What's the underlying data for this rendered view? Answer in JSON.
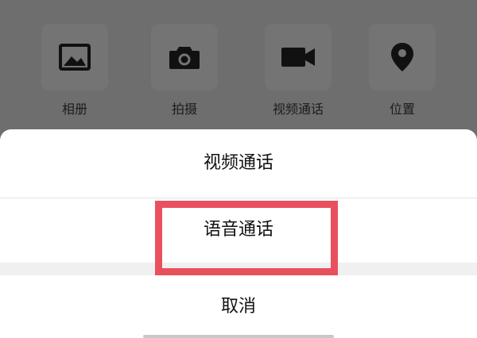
{
  "tools": [
    {
      "label": "相册",
      "icon": "image-icon"
    },
    {
      "label": "拍摄",
      "icon": "camera-icon"
    },
    {
      "label": "视频通话",
      "icon": "video-icon"
    },
    {
      "label": "位置",
      "icon": "location-pin-icon"
    }
  ],
  "sheet": {
    "video_call": "视频通话",
    "voice_call": "语音通话",
    "cancel": "取消"
  },
  "colors": {
    "overlay": "#6e6e6e",
    "highlight": "#e9505e",
    "sheet_bg": "#ffffff"
  }
}
